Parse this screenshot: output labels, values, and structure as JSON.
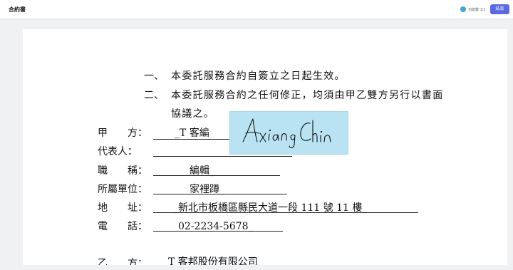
{
  "header": {
    "title": "合約書",
    "status": "功能鍵 1/1",
    "finish_label": "結束",
    "status_color": "#3aa9d8",
    "button_color": "#5a6ae0"
  },
  "clauses": [
    {
      "num": "一、",
      "text": "本委託服務合約自簽立之日起生效。"
    },
    {
      "num": "二、",
      "text": "本委託服務合約之任何修正，均須由甲乙雙方另行以書面"
    },
    {
      "num": "",
      "text": "協議之。"
    }
  ],
  "party_a": {
    "fields": [
      {
        "label": "甲　　方：",
        "value": "_T 客編"
      },
      {
        "label": "代表人：",
        "value": ""
      },
      {
        "label": "職　　稱：",
        "value": "編輯_"
      },
      {
        "label": "所屬單位：",
        "value": "家裡蹲_"
      },
      {
        "label": "地　　址：",
        "value": "_新北市板橋區縣民大道一段 111 號 11 樓_"
      },
      {
        "label": "電　　話：",
        "value": "02-2234-5678_"
      }
    ]
  },
  "party_b": {
    "label": "乙　　方：",
    "value": "T 客邦股份有限公司"
  },
  "signature": {
    "text": "Axiang Chin"
  }
}
